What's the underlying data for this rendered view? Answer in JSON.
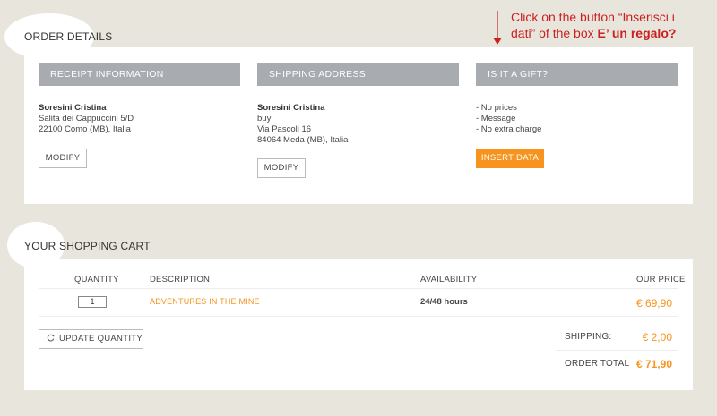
{
  "annotation": {
    "text": "Click on the button “Inserisci i dati” of the box",
    "highlight": "E’ un regalo?"
  },
  "order_details": {
    "title": "ORDER DETAILS",
    "receipt": {
      "header": "RECEIPT INFORMATION",
      "name": "Soresini Cristina",
      "lines": [
        "Salita dei Cappuccini 5/D",
        "22100 Como (MB), Italia"
      ],
      "button": "MODIFY"
    },
    "shipping": {
      "header": "SHIPPING ADDRESS",
      "name": "Soresini Cristina",
      "lines": [
        "buy",
        "Via Pascoli 16",
        "84064 Meda (MB), Italia"
      ],
      "button": "MODIFY"
    },
    "gift": {
      "header": "IS IT A GIFT?",
      "lines": [
        "- No prices",
        "- Message",
        "- No extra charge"
      ],
      "button": "INSERT DATA"
    }
  },
  "cart": {
    "title": "YOUR SHOPPING CART",
    "headers": {
      "quantity": "QUANTITY",
      "description": "DESCRIPTION",
      "availability": "AVAILABILITY",
      "price": "OUR PRICE"
    },
    "row": {
      "quantity": "1",
      "description": "ADVENTURES IN THE MINE",
      "availability": "24/48 hours",
      "price": "€ 69,90"
    },
    "update_button": "UPDATE QUANTITY",
    "shipping_label": "SHIPPING:",
    "shipping_value": "€ 2,00",
    "total_label": "ORDER TOTAL",
    "total_value": "€ 71,90"
  },
  "colors": {
    "accent": "#f7941d",
    "header_gray": "#a8abaf",
    "background": "#e8e6dc",
    "annotation_red": "#cc1f1f"
  }
}
